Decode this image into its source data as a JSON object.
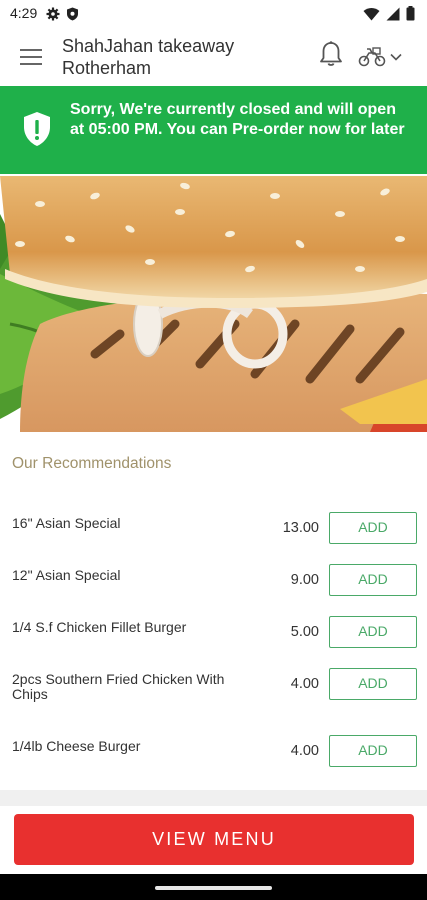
{
  "status_bar": {
    "time": "4:29",
    "icons": [
      "settings-icon",
      "shield-icon",
      "wifi-icon",
      "signal-icon",
      "battery-icon"
    ]
  },
  "header": {
    "title": "ShahJahan takeaway Rotherham",
    "icons": [
      "menu-icon",
      "bell-icon",
      "delivery-bike-icon",
      "chevron-down-icon"
    ]
  },
  "banner": {
    "message": "Sorry, We're currently closed and will open at 05:00 PM. You can Pre-order now for later",
    "icon": "shield-exclamation-icon",
    "color": "#1fb04a"
  },
  "hero": {
    "image": "grilled-chicken-burger"
  },
  "recommendations": {
    "title": "Our Recommendations",
    "add_label": "ADD",
    "items": [
      {
        "name": "16\" Asian Special",
        "price": "13.00"
      },
      {
        "name": "12\" Asian Special",
        "price": "9.00"
      },
      {
        "name": "1/4 S.f Chicken Fillet Burger",
        "price": "5.00"
      },
      {
        "name": "2pcs Southern Fried Chicken With Chips",
        "price": "4.00"
      },
      {
        "name": "1/4lb Cheese Burger",
        "price": "4.00"
      }
    ]
  },
  "footer": {
    "view_menu_label": "VIEW MENU",
    "button_color": "#e8302f"
  },
  "colors": {
    "accent_green": "#4aa968",
    "heading_gold": "#a0926b"
  }
}
